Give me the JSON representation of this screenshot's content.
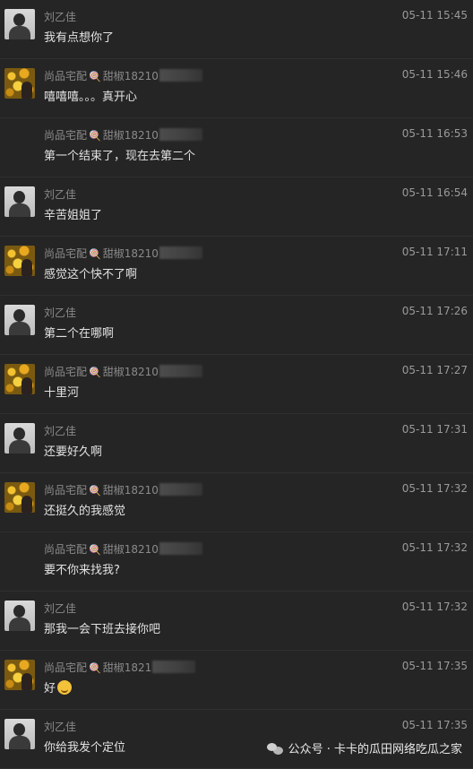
{
  "messages": [
    {
      "avatar": "person",
      "sender": "刘乙佳",
      "suffix": "",
      "time": "05-11 15:45",
      "text": "我有点想你了"
    },
    {
      "avatar": "flower",
      "sender": "尚品宅配",
      "suffix": "甜椒18210",
      "time": "05-11 15:46",
      "text": "嘻嘻嘻。。。真开心"
    },
    {
      "avatar": "none",
      "sender": "尚品宅配",
      "suffix": "甜椒18210",
      "time": "05-11 16:53",
      "text": "第一个结束了，现在去第二个"
    },
    {
      "avatar": "person",
      "sender": "刘乙佳",
      "suffix": "",
      "time": "05-11 16:54",
      "text": "辛苦姐姐了"
    },
    {
      "avatar": "flower",
      "sender": "尚品宅配",
      "suffix": "甜椒18210",
      "time": "05-11 17:11",
      "text": "感觉这个快不了啊"
    },
    {
      "avatar": "person",
      "sender": "刘乙佳",
      "suffix": "",
      "time": "05-11 17:26",
      "text": "第二个在哪啊"
    },
    {
      "avatar": "flower",
      "sender": "尚品宅配",
      "suffix": "甜椒18210",
      "time": "05-11 17:27",
      "text": "十里河"
    },
    {
      "avatar": "person",
      "sender": "刘乙佳",
      "suffix": "",
      "time": "05-11 17:31",
      "text": "还要好久啊"
    },
    {
      "avatar": "flower",
      "sender": "尚品宅配",
      "suffix": "甜椒18210",
      "time": "05-11 17:32",
      "text": "还挺久的我感觉"
    },
    {
      "avatar": "none",
      "sender": "尚品宅配",
      "suffix": "甜椒18210",
      "time": "05-11 17:32",
      "text": "要不你来找我?"
    },
    {
      "avatar": "person",
      "sender": "刘乙佳",
      "suffix": "",
      "time": "05-11 17:32",
      "text": "那我一会下班去接你吧"
    },
    {
      "avatar": "flower",
      "sender": "尚品宅配",
      "suffix": "甜椒1821",
      "time": "05-11 17:35",
      "text": "好"
    },
    {
      "avatar": "person",
      "sender": "刘乙佳",
      "suffix": "",
      "time": "05-11 17:35",
      "text": "你给我发个定位"
    }
  ],
  "watermark": {
    "text": "公众号 · 卡卡的瓜田网络吃瓜之家"
  }
}
